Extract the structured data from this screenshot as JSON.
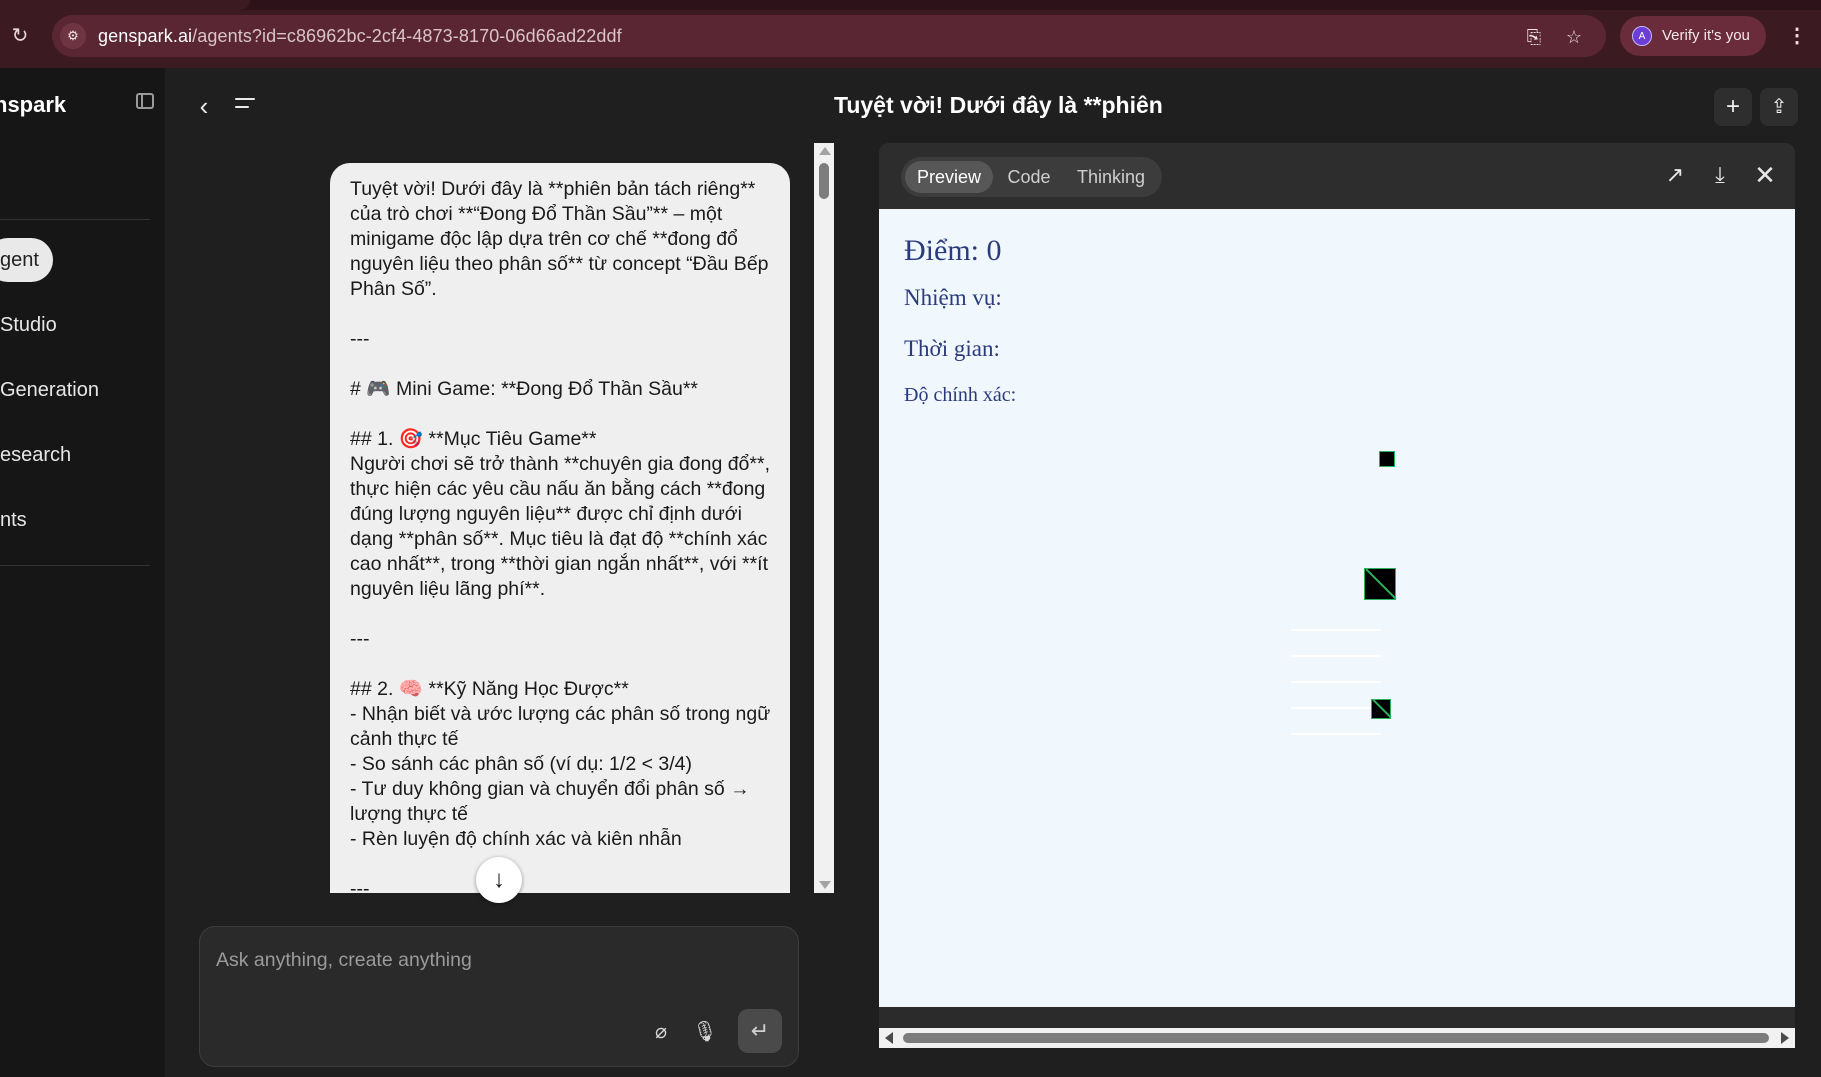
{
  "browser": {
    "url_host": "genspark.ai",
    "url_path": "/agents?id=c86962bc-2cf4-4873-8170-06d66ad22ddf",
    "verify_label": "Verify it's you",
    "avatar_letter": "A"
  },
  "sidebar": {
    "brand": "nspark",
    "items": [
      {
        "label": "gent",
        "active": true
      },
      {
        "label": "Studio"
      },
      {
        "label": "Generation"
      },
      {
        "label": "esearch"
      },
      {
        "label": "nts"
      }
    ]
  },
  "header": {
    "title": "Tuyệt vời! Dưới đây là **phiên"
  },
  "chat": {
    "message_paragraphs": [
      "Tuyệt vời! Dưới đây là **phiên bản tách riêng** của trò chơi **“Đong Đổ Thần Sầu”** – một minigame độc lập dựa trên cơ chế **đong đổ nguyên liệu theo phân số** từ concept “Đầu Bếp Phân Số”.",
      "---",
      "# 🎮 Mini Game: **Đong Đổ Thần Sầu**",
      "## 1. 🎯 **Mục Tiêu Game**\nNgười chơi sẽ trở thành **chuyên gia đong đổ**, thực hiện các yêu cầu nấu ăn bằng cách **đong đúng lượng nguyên liệu** được chỉ định dưới dạng **phân số**. Mục tiêu là đạt độ **chính xác cao nhất**, trong **thời gian ngắn nhất**, với **ít nguyên liệu lãng phí**.",
      "---",
      "## 2. 🧠 **Kỹ Năng Học Được**\n- Nhận biết và ước lượng các phân số trong ngữ cảnh thực tế\n- So sánh các phân số (ví dụ: 1/2 < 3/4)\n- Tư duy không gian và chuyển đổi phân số → lượng thực tế\n- Rèn luyện độ chính xác và kiên nhẫn",
      "---"
    ],
    "composer_placeholder": "Ask anything, create anything"
  },
  "preview": {
    "tabs": [
      {
        "label": "Preview",
        "active": true
      },
      {
        "label": "Code"
      },
      {
        "label": "Thinking"
      }
    ],
    "game": {
      "score": "Điểm: 0",
      "mission": "Nhiệm vụ:",
      "time": "Thời gian:",
      "accuracy": "Độ chính xác:"
    }
  }
}
